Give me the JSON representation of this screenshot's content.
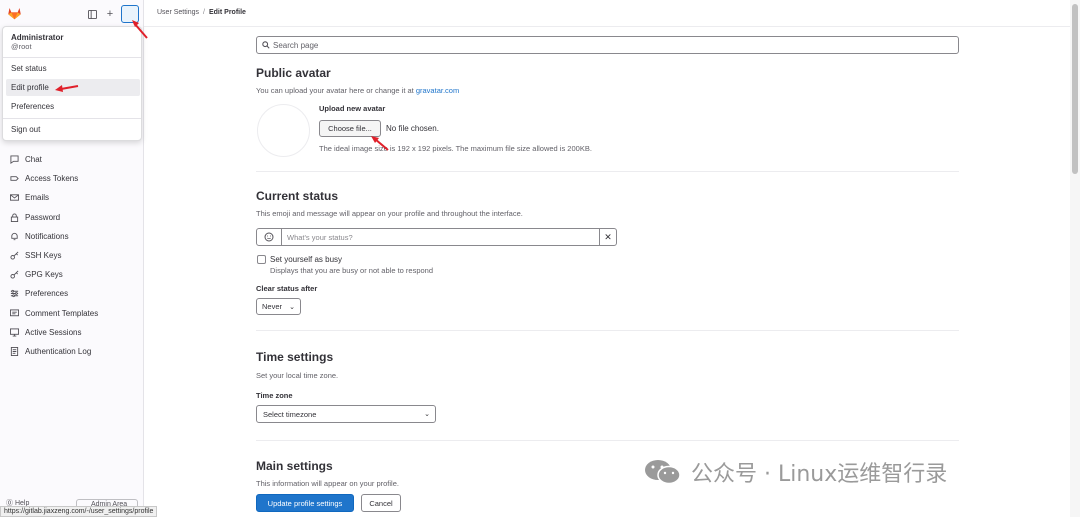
{
  "breadcrumb": {
    "parent": "User Settings",
    "separator": "/",
    "current": "Edit Profile"
  },
  "search": {
    "placeholder": "Search page"
  },
  "user_menu": {
    "name": "Administrator",
    "username": "@root",
    "items": [
      "Set status",
      "Edit profile",
      "Preferences",
      "Sign out"
    ]
  },
  "sidebar": {
    "items": [
      {
        "label": "Chat",
        "icon": "chat-icon"
      },
      {
        "label": "Access Tokens",
        "icon": "token-icon"
      },
      {
        "label": "Emails",
        "icon": "mail-icon"
      },
      {
        "label": "Password",
        "icon": "lock-icon"
      },
      {
        "label": "Notifications",
        "icon": "bell-icon"
      },
      {
        "label": "SSH Keys",
        "icon": "key-icon"
      },
      {
        "label": "GPG Keys",
        "icon": "key-icon"
      },
      {
        "label": "Preferences",
        "icon": "preferences-icon"
      },
      {
        "label": "Comment Templates",
        "icon": "comment-icon"
      },
      {
        "label": "Active Sessions",
        "icon": "monitor-icon"
      },
      {
        "label": "Authentication Log",
        "icon": "log-icon"
      }
    ],
    "help_label": "Help",
    "admin_label": "Admin Area"
  },
  "status_url": "https://gitlab.jiaxzeng.com/-/user_settings/profile",
  "avatar": {
    "title": "Public avatar",
    "desc_prefix": "You can upload your avatar here or change it at ",
    "desc_link": "gravatar.com",
    "upload_label": "Upload new avatar",
    "choose_button": "Choose file...",
    "no_file": "No file chosen.",
    "ideal_text": "The ideal image size is 192 x 192 pixels. The maximum file size allowed is 200KB."
  },
  "current_status": {
    "title": "Current status",
    "desc": "This emoji and message will appear on your profile and throughout the interface.",
    "placeholder": "What's your status?",
    "busy_label": "Set yourself as busy",
    "busy_help": "Displays that you are busy or not able to respond",
    "clear_after_label": "Clear status after",
    "clear_after_value": "Never"
  },
  "time_settings": {
    "title": "Time settings",
    "desc": "Set your local time zone.",
    "timezone_label": "Time zone",
    "timezone_value": "Select timezone"
  },
  "main_settings": {
    "title": "Main settings",
    "desc": "This information will appear on your profile."
  },
  "actions": {
    "update": "Update profile settings",
    "cancel": "Cancel"
  },
  "watermark": "公众号 · Linux运维智行录",
  "colors": {
    "primary": "#1f75cb",
    "annotation_arrow": "#e0202a"
  }
}
